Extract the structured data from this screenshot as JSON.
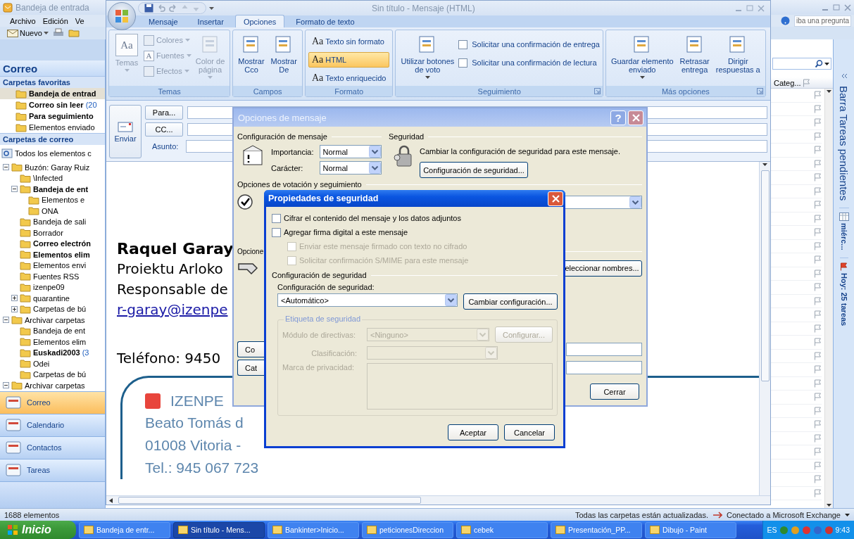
{
  "outlook": {
    "title": "Bandeja de entrada",
    "menu": [
      "Archivo",
      "Edición",
      "Ve"
    ],
    "new_button": "Nuevo",
    "question": "iba una pregunta",
    "nav": {
      "header": "Correo",
      "favorites_header": "Carpetas favoritas",
      "favorites": [
        {
          "label": "Bandeja de entrad",
          "unread": true,
          "selected": true
        },
        {
          "label": "Correo sin leer",
          "count": "(20",
          "unread": true,
          "selected": false
        },
        {
          "label": "Para seguimiento",
          "unread": true,
          "selected": false
        },
        {
          "label": "Elementos enviado",
          "unread": false,
          "selected": false
        }
      ],
      "folders_header": "Carpetas de correo",
      "all_items": "Todos los elementos c",
      "tree": [
        {
          "label": "Buzón: Garay Ruiz",
          "unread": false,
          "expanded": true,
          "children": [
            {
              "label": "\\Infected",
              "unread": false
            },
            {
              "label": "Bandeja de ent",
              "unread": true,
              "expanded": true,
              "children": [
                {
                  "label": "Elementos e",
                  "unread": false
                },
                {
                  "label": "ONA",
                  "unread": false
                }
              ]
            },
            {
              "label": "Bandeja de sali",
              "unread": false
            },
            {
              "label": "Borrador",
              "unread": false
            },
            {
              "label": "Correo electrón",
              "unread": true
            },
            {
              "label": "Elementos elim",
              "unread": true
            },
            {
              "label": "Elementos envi",
              "unread": false
            },
            {
              "label": "Fuentes RSS",
              "unread": false
            },
            {
              "label": "izenpe09",
              "unread": false
            },
            {
              "label": "quarantine",
              "unread": false,
              "expanded": false
            },
            {
              "label": "Carpetas de bú",
              "unread": false,
              "expanded": false
            }
          ]
        },
        {
          "label": "Archivar carpetas",
          "unread": false,
          "expanded": true,
          "children": [
            {
              "label": "Bandeja de ent",
              "unread": false
            },
            {
              "label": "Elementos elim",
              "unread": false
            },
            {
              "label": "Euskadi2003",
              "count": "(3",
              "unread": true
            },
            {
              "label": "Odei",
              "unread": false
            },
            {
              "label": "Carpetas de bú",
              "unread": false
            }
          ]
        },
        {
          "label": "Archivar carpetas",
          "unread": false,
          "expanded": true
        }
      ],
      "buttons": [
        {
          "label": "Correo",
          "selected": true
        },
        {
          "label": "Calendario",
          "selected": false
        },
        {
          "label": "Contactos",
          "selected": false
        },
        {
          "label": "Tareas",
          "selected": false
        }
      ]
    },
    "list": {
      "column": "Categ..."
    },
    "todo_bar": {
      "title": "Barra Tareas pendientes",
      "date": "miérc...",
      "tasks": "Hoy: 25 tareas"
    }
  },
  "status_bar": {
    "count": "1688 elementos",
    "sync": "Todas las carpetas están actualizadas.",
    "connection": "Conectado a Microsoft Exchange"
  },
  "compose": {
    "title": "Sin título - Mensaje (HTML)",
    "tabs": [
      {
        "label": "Mensaje",
        "selected": false
      },
      {
        "label": "Insertar",
        "selected": false
      },
      {
        "label": "Opciones",
        "selected": true
      },
      {
        "label": "Formato de texto",
        "selected": false
      }
    ],
    "ribbon": [
      {
        "label": "Temas",
        "launcher": false,
        "items": [
          {
            "kind": "big",
            "label": "Temas",
            "glyph": "Aa",
            "disabled": true,
            "menu": true
          },
          {
            "kind": "small",
            "label": "Colores",
            "disabled": true,
            "menu": true
          },
          {
            "kind": "small",
            "label": "Fuentes",
            "glyph": "A",
            "disabled": true,
            "menu": true
          },
          {
            "kind": "small",
            "label": "Efectos",
            "disabled": true,
            "menu": true
          },
          {
            "kind": "big",
            "label": "Color de\npágina",
            "disabled": true,
            "menu": true
          }
        ]
      },
      {
        "label": "Campos",
        "launcher": false,
        "items": [
          {
            "kind": "big",
            "label": "Mostrar\nCco",
            "disabled": false,
            "menu": false
          },
          {
            "kind": "big",
            "label": "Mostrar\nDe",
            "disabled": false,
            "menu": false
          }
        ]
      },
      {
        "label": "Formato",
        "launcher": false,
        "items": [
          {
            "kind": "option",
            "glyph": "Aa",
            "label": "Texto sin formato",
            "selected": false
          },
          {
            "kind": "option",
            "glyph": "Aa",
            "label": "HTML",
            "selected": true
          },
          {
            "kind": "option",
            "glyph": "Aa",
            "label": "Texto enriquecido",
            "selected": false
          }
        ]
      },
      {
        "label": "Seguimiento",
        "launcher": true,
        "items": [
          {
            "kind": "big",
            "label": "Utilizar botones\nde voto",
            "disabled": false,
            "menu": true
          },
          {
            "kind": "check",
            "label": "Solicitar una confirmación de entrega",
            "checked": false
          },
          {
            "kind": "check",
            "label": "Solicitar una confirmación de lectura",
            "checked": false
          }
        ]
      },
      {
        "label": "Más opciones",
        "launcher": true,
        "items": [
          {
            "kind": "big",
            "label": "Guardar elemento\nenviado",
            "disabled": false,
            "menu": true
          },
          {
            "kind": "big",
            "label": "Retrasar\nentrega",
            "disabled": false,
            "menu": false
          },
          {
            "kind": "big",
            "label": "Dirigir\nrespuestas a",
            "disabled": false,
            "menu": false
          }
        ]
      }
    ],
    "send": "Enviar",
    "to": "Para...",
    "cc": "CC...",
    "subject_label": "Asunto:",
    "body": {
      "name": "Raquel Garay",
      "lines": [
        "Proiektu Arloko",
        "Responsable de"
      ],
      "email": "r-garay@izenpe",
      "phone": "Teléfono: 9450",
      "card": {
        "company": "IZENPE",
        "lines": [
          "Beato Tomás d",
          "01008 Vitoria -",
          "Tel.: 945 067 723"
        ]
      }
    }
  },
  "message_options": {
    "title": "Opciones de mensaje",
    "help": "?",
    "settings": {
      "legend": "Configuración de mensaje",
      "importance_label": "Importancia:",
      "importance": "Normal",
      "sensitivity_label": "Carácter:",
      "sensitivity": "Normal"
    },
    "security": {
      "legend": "Seguridad",
      "text": "Cambiar la configuración de seguridad para este mensaje.",
      "button": "Configuración de seguridad..."
    },
    "voting_legend": "Opciones de votación y seguimiento",
    "delivery_legend": "Opcione",
    "select_names": "eleccionar nombres...",
    "button_1": "Co",
    "button_2": "Cat",
    "close": "Cerrar"
  },
  "security_properties": {
    "title": "Propiedades de seguridad",
    "options": [
      {
        "label": "Cifrar el contenido del mensaje y los datos adjuntos",
        "checked": false,
        "disabled": false
      },
      {
        "label": "Agregar firma digital a este mensaje",
        "checked": false,
        "disabled": false,
        "children": [
          {
            "label": "Enviar este mensaje firmado con texto no cifrado",
            "checked": false,
            "disabled": true
          },
          {
            "label": "Solicitar confirmación S/MIME para este mensaje",
            "checked": false,
            "disabled": true
          }
        ]
      }
    ],
    "settings_legend": "Configuración de seguridad",
    "settings_label": "Configuración de seguridad:",
    "setting": "<Automático>",
    "change": "Cambiar configuración...",
    "label_group": {
      "legend": "Etiqueta de seguridad",
      "disabled": true,
      "policy_label": "Módulo de directivas:",
      "policy": "<Ninguno>",
      "configure": "Configurar...",
      "classification_label": "Clasificación:",
      "privacy_label": "Marca de privacidad:"
    },
    "ok": "Aceptar",
    "cancel": "Cancelar"
  },
  "taskbar": {
    "start": "Inicio",
    "items": [
      {
        "label": "Bandeja de entr...",
        "selected": false
      },
      {
        "label": "Sin título - Mens...",
        "selected": true
      },
      {
        "label": "Bankinter>Inicio...",
        "selected": false
      },
      {
        "label": "peticionesDireccion",
        "selected": false
      },
      {
        "label": "cebek",
        "selected": false
      },
      {
        "label": "Presentación_PP...",
        "selected": false
      },
      {
        "label": "Dibujo - Paint",
        "selected": false
      }
    ],
    "language": "ES",
    "clock": "9:43"
  }
}
